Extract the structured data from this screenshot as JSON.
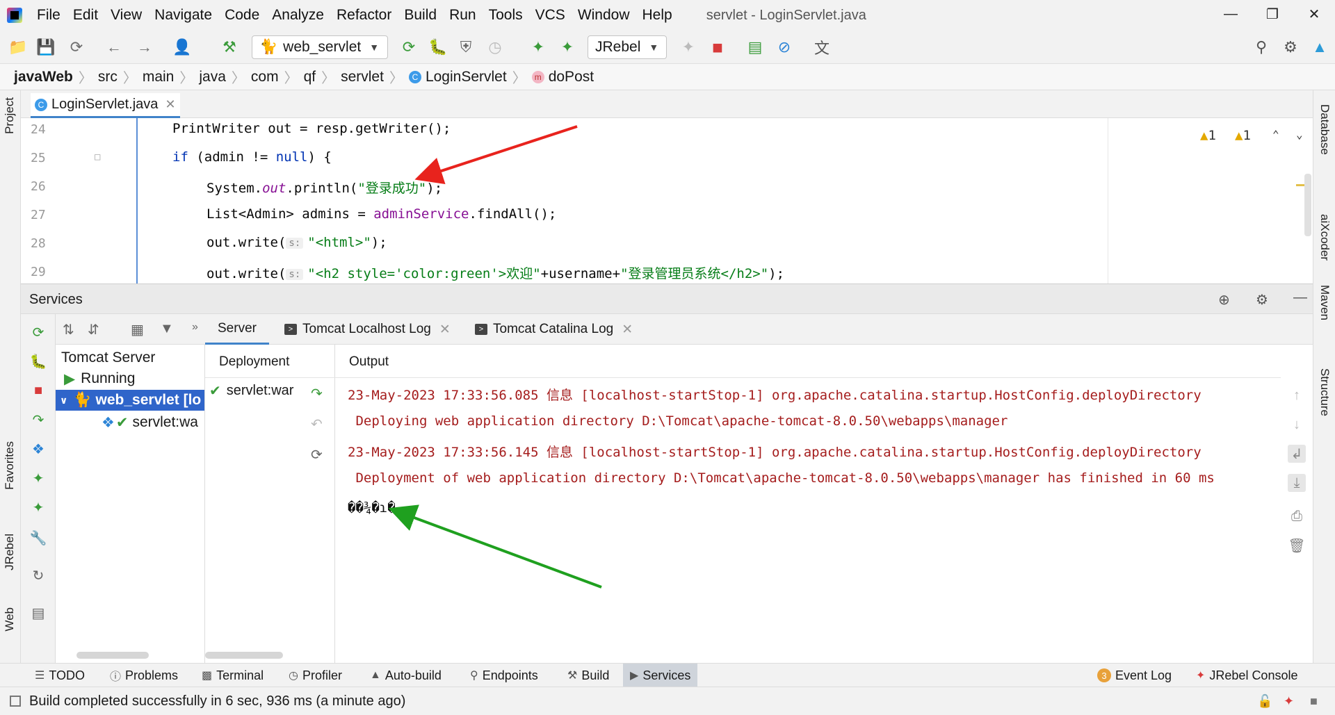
{
  "menubar": {
    "items": [
      "File",
      "Edit",
      "View",
      "Navigate",
      "Code",
      "Analyze",
      "Refactor",
      "Build",
      "Run",
      "Tools",
      "VCS",
      "Window",
      "Help"
    ],
    "window_title": "servlet - LoginServlet.java"
  },
  "toolbar": {
    "run_config": "web_servlet",
    "jrebel_combo": "JRebel"
  },
  "breadcrumb": [
    "javaWeb",
    "src",
    "main",
    "java",
    "com",
    "qf",
    "servlet",
    "LoginServlet",
    "doPost"
  ],
  "editor": {
    "tab_label": "LoginServlet.java",
    "warnings_a": "1",
    "warnings_b": "1",
    "lines": [
      {
        "no": "24"
      },
      {
        "no": "25"
      },
      {
        "no": "26"
      },
      {
        "no": "27"
      },
      {
        "no": "28"
      },
      {
        "no": "29"
      }
    ],
    "code": {
      "l24": "PrintWriter out = resp.getWriter();",
      "l25_kw": "if",
      "l25_rest": " (admin != ",
      "l25_null": "null",
      "l25_end": ") {",
      "l26_a": "System.",
      "l26_out": "out",
      "l26_b": ".println(",
      "l26_str": "\"登录成功\"",
      "l26_c": ");",
      "l27_a": "List<Admin> admins = ",
      "l27_svc": "adminService",
      "l27_b": ".findAll();",
      "l28_a": "out.write(",
      "l28_hint": "s:",
      "l28_str": "\"<html>\"",
      "l28_b": ");",
      "l29_a": "out.write(",
      "l29_hint": "s:",
      "l29_str1": "\"<h2 style='color:green'>欢迎\"",
      "l29_b": "+username+",
      "l29_str2": "\"登录管理员系统</h2>\"",
      "l29_c": ");"
    }
  },
  "services": {
    "title": "Services",
    "tree": {
      "root": "Tomcat Server",
      "running": "Running",
      "config": "web_servlet [lo",
      "artifact": "servlet:wa"
    },
    "tabs": [
      "Server",
      "Tomcat Localhost Log",
      "Tomcat Catalina Log"
    ],
    "deployment_header": "Deployment",
    "deployment_item": "servlet:war",
    "output_header": "Output",
    "output_lines": [
      "23-May-2023 17:33:56.085 信息 [localhost-startStop-1] org.apache.catalina.startup.HostConfig.deployDirectory",
      " Deploying web application directory D:\\Tomcat\\apache-tomcat-8.0.50\\webapps\\manager",
      "23-May-2023 17:33:56.145 信息 [localhost-startStop-1] org.apache.catalina.startup.HostConfig.deployDirectory",
      " Deployment of web application directory D:\\Tomcat\\apache-tomcat-8.0.50\\webapps\\manager has finished in 60 ms"
    ],
    "garbled_line": "��¾�ɿ�"
  },
  "left_stripe": {
    "project": "Project",
    "favorites": "Favorites",
    "jrebel": "JRebel",
    "web": "Web"
  },
  "right_stripe": {
    "database": "Database",
    "aixcoder": "aiXcoder",
    "maven": "Maven",
    "structure": "Structure"
  },
  "bottom_tabs": [
    {
      "label": "TODO"
    },
    {
      "label": "Problems"
    },
    {
      "label": "Terminal"
    },
    {
      "label": "Profiler"
    },
    {
      "label": "Auto-build"
    },
    {
      "label": "Endpoints"
    },
    {
      "label": "Build"
    },
    {
      "label": "Services"
    }
  ],
  "bottom_right": {
    "event_log": "Event Log",
    "event_count": "3",
    "jrebel_console": "JRebel Console"
  },
  "status": {
    "message": "Build completed successfully in 6 sec, 936 ms (a minute ago)"
  },
  "colors": {
    "accent": "#2f65ca",
    "arrow_red": "#e8231d",
    "arrow_green": "#1fa01f",
    "log_red": "#a51d1d"
  }
}
